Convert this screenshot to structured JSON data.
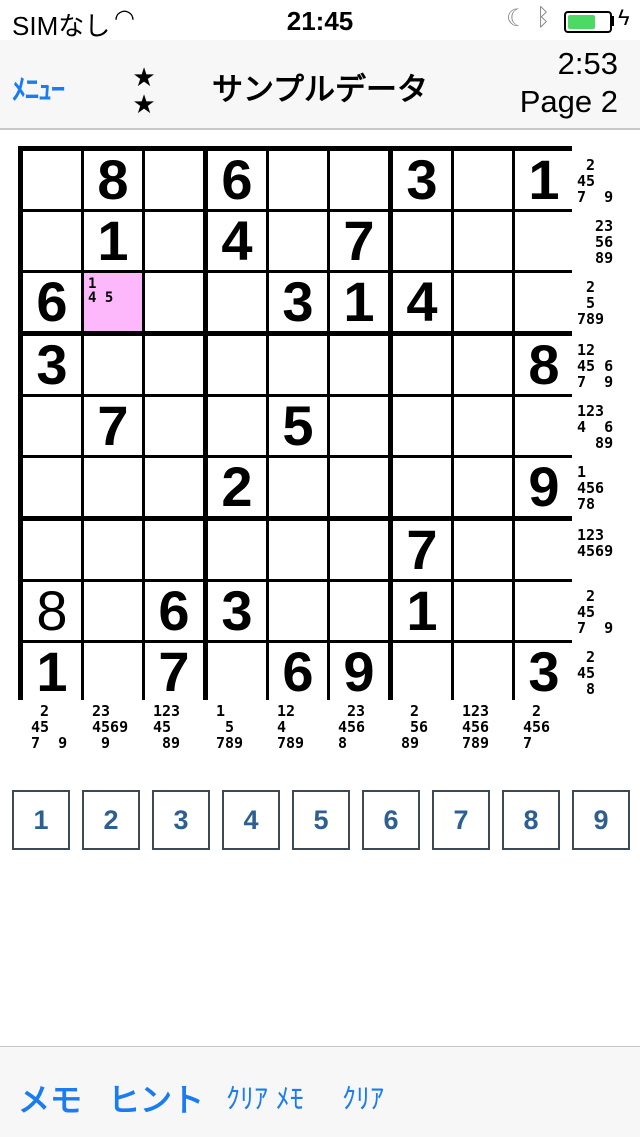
{
  "status": {
    "carrier": "SIMなし",
    "time": "21:45",
    "battery_level": 0.7
  },
  "nav": {
    "menu": "ﾒﾆｭｰ",
    "stars": [
      "★",
      "★"
    ],
    "title": "サンプルデータ",
    "timer": "2:53",
    "page": "Page 2"
  },
  "board": {
    "cells": [
      [
        "",
        "8",
        "",
        "6",
        "",
        "",
        "3",
        "",
        "1"
      ],
      [
        "",
        "1",
        "",
        "4",
        "",
        "7",
        "",
        "",
        ""
      ],
      [
        "6",
        "",
        "",
        "",
        "3",
        "1",
        "4",
        "",
        ""
      ],
      [
        "3",
        "",
        "",
        "",
        "",
        "",
        "",
        "",
        "8"
      ],
      [
        "",
        "7",
        "",
        "",
        "5",
        "",
        "",
        "",
        ""
      ],
      [
        "",
        "",
        "",
        "2",
        "",
        "",
        "",
        "",
        "9"
      ],
      [
        "",
        "",
        "",
        "",
        "",
        "",
        "7",
        "",
        ""
      ],
      [
        "8",
        "",
        "6",
        "3",
        "",
        "",
        "1",
        "",
        ""
      ],
      [
        "1",
        "",
        "7",
        "",
        "6",
        "9",
        "",
        "",
        "3"
      ]
    ],
    "selected_cell": {
      "row": 3,
      "col": 2,
      "memo": "1\n4 5"
    },
    "highlight_color": "#fdb8fb"
  },
  "row_candidates": [
    " 2\n45\n7  9",
    "  23\n  56\n  89",
    " 2\n 5\n789",
    "12\n45 6\n7  9",
    "123\n4  6\n  89",
    "1\n456\n78",
    "123\n4569\n",
    " 2\n45\n7  9",
    " 2\n45\n 8"
  ],
  "col_candidates": [
    " 2\n45\n7  9",
    "23\n4569\n 9",
    "123\n45\n 89",
    "1\n 5\n789",
    "12\n4\n789",
    " 23\n456\n8",
    " 2\n 56\n89",
    "123\n456\n789",
    " 2\n456\n7"
  ],
  "numpad": [
    "1",
    "2",
    "3",
    "4",
    "5",
    "6",
    "7",
    "8",
    "9"
  ],
  "toolbar": {
    "memo": "メモ",
    "hint": "ヒント",
    "clear_memo": "ｸﾘｱ ﾒﾓ",
    "clear": "ｸﾘｱ"
  },
  "colors": {
    "accent": "#1a7cf0",
    "numpad_text": "#2d5f91"
  }
}
